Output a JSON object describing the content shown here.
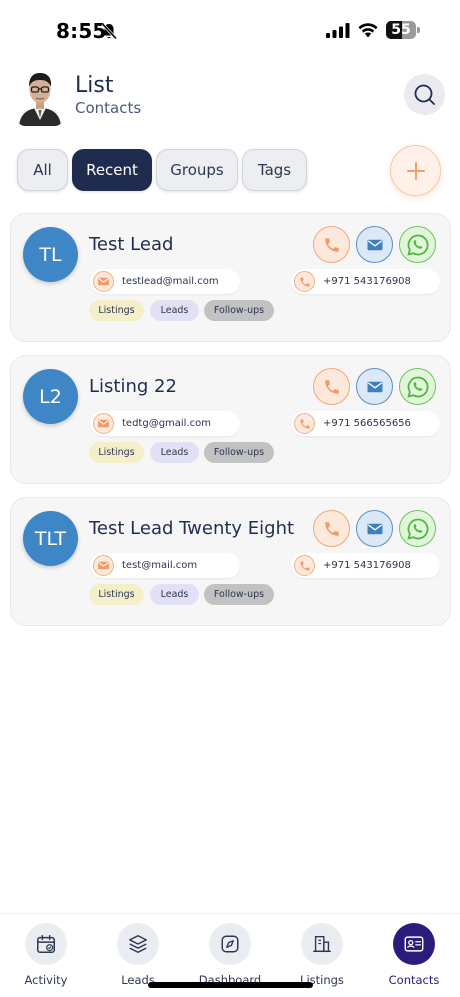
{
  "status_bar": {
    "time": "8:55",
    "battery": "55"
  },
  "header": {
    "title": "List",
    "subtitle": "Contacts"
  },
  "tabs": [
    {
      "label": "All",
      "active": false
    },
    {
      "label": "Recent",
      "active": true
    },
    {
      "label": "Groups",
      "active": false
    },
    {
      "label": "Tags",
      "active": false
    }
  ],
  "contacts": [
    {
      "initials": "TL",
      "name": "Test Lead",
      "email": "testlead@mail.com",
      "phone": "+971 543176908",
      "tags": [
        "Listings",
        "Leads",
        "Follow-ups"
      ]
    },
    {
      "initials": "L2",
      "name": "Listing 22",
      "email": "tedtg@gmail.com",
      "phone": "+971 566565656",
      "tags": [
        "Listings",
        "Leads",
        "Follow-ups"
      ]
    },
    {
      "initials": "TLT",
      "name": "Test Lead Twenty Eight",
      "email": "test@mail.com",
      "phone": "+971 543176908",
      "tags": [
        "Listings",
        "Leads",
        "Follow-ups"
      ]
    }
  ],
  "bottom_nav": [
    {
      "label": "Activity",
      "icon": "calendar-icon",
      "active": false
    },
    {
      "label": "Leads",
      "icon": "layers-icon",
      "active": false
    },
    {
      "label": "Dashboard",
      "icon": "compass-icon",
      "active": false
    },
    {
      "label": "Listings",
      "icon": "building-icon",
      "active": false
    },
    {
      "label": "Contacts",
      "icon": "contact-card-icon",
      "active": true
    }
  ],
  "colors": {
    "primary_navy": "#1f2b4f",
    "avatar_blue": "#3f86c6",
    "call_orange": "#f0a878",
    "mail_blue": "#5a8fc4",
    "whatsapp_green": "#6cc45a",
    "active_nav": "#2a1c7a"
  }
}
